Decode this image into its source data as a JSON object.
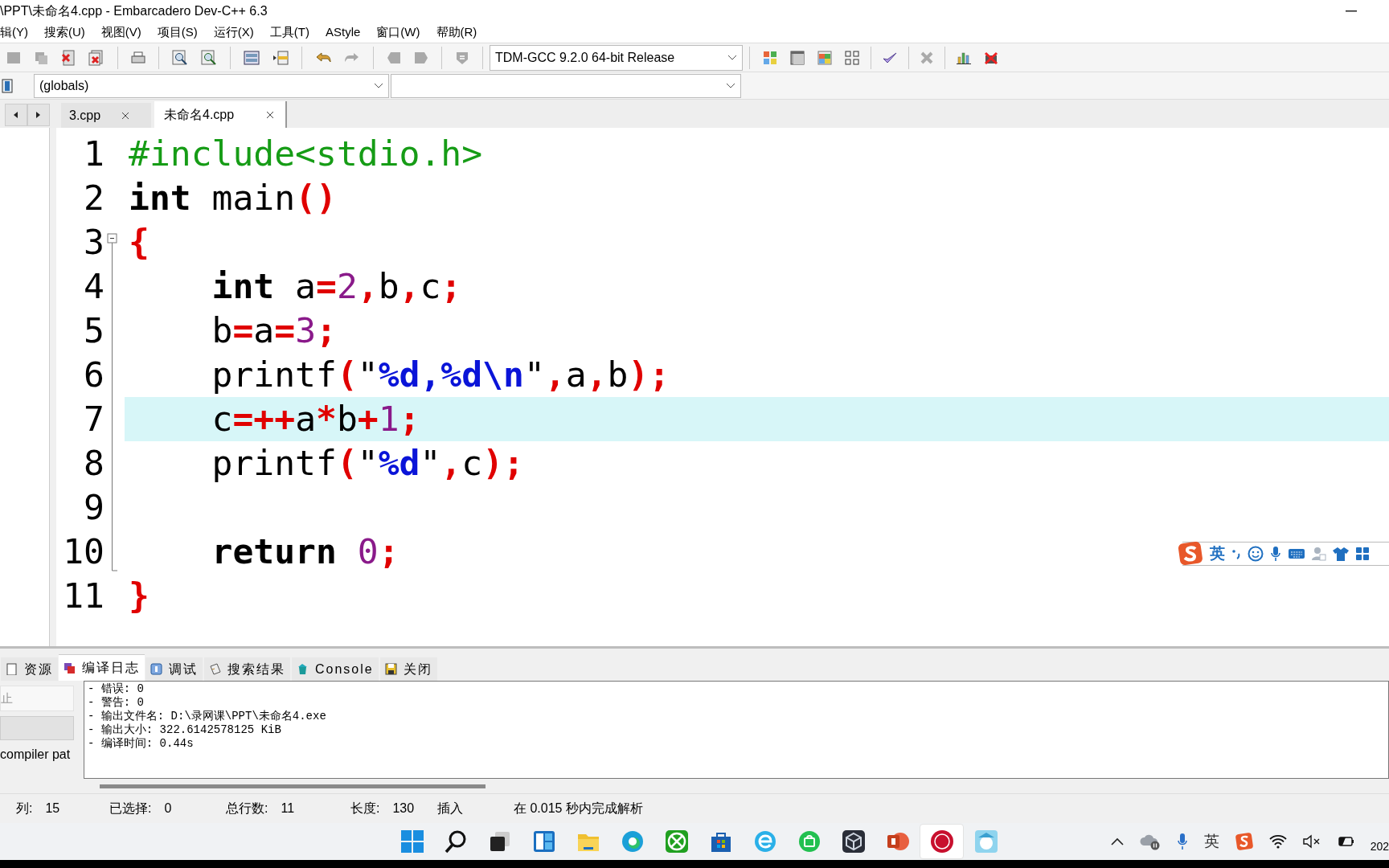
{
  "window": {
    "title": "\\PPT\\未命名4.cpp - Embarcadero Dev-C++ 6.3"
  },
  "menu": [
    "辑(Y)",
    "搜索(U)",
    "视图(V)",
    "项目(S)",
    "运行(X)",
    "工具(T)",
    "AStyle",
    "窗口(W)",
    "帮助(R)"
  ],
  "toolbar": {
    "compiler": "TDM-GCC 9.2.0 64-bit Release"
  },
  "class_bar": {
    "scope": "(globals)"
  },
  "file_tabs": [
    {
      "label": "3.cpp",
      "selected": false
    },
    {
      "label": "未命名4.cpp",
      "selected": true
    }
  ],
  "editor": {
    "lines": [
      {
        "number": "1",
        "highlighted": false,
        "tokens": [
          {
            "kind": "pre",
            "text": "#include<stdio.h>"
          }
        ]
      },
      {
        "number": "2",
        "highlighted": false,
        "tokens": [
          {
            "kind": "kw",
            "text": "int"
          },
          {
            "kind": "id",
            "text": " main"
          },
          {
            "kind": "sym",
            "text": "()"
          }
        ]
      },
      {
        "number": "3",
        "highlighted": false,
        "tokens": [
          {
            "kind": "sym",
            "text": "{"
          }
        ]
      },
      {
        "number": "4",
        "highlighted": false,
        "tokens": [
          {
            "kind": "kw",
            "text": "    int"
          },
          {
            "kind": "id",
            "text": " a"
          },
          {
            "kind": "sym",
            "text": "="
          },
          {
            "kind": "num",
            "text": "2"
          },
          {
            "kind": "sym",
            "text": ","
          },
          {
            "kind": "id",
            "text": "b"
          },
          {
            "kind": "sym",
            "text": ","
          },
          {
            "kind": "id",
            "text": "c"
          },
          {
            "kind": "sym",
            "text": ";"
          }
        ]
      },
      {
        "number": "5",
        "highlighted": false,
        "tokens": [
          {
            "kind": "id",
            "text": "    b"
          },
          {
            "kind": "sym",
            "text": "="
          },
          {
            "kind": "id",
            "text": "a"
          },
          {
            "kind": "sym",
            "text": "="
          },
          {
            "kind": "num",
            "text": "3"
          },
          {
            "kind": "sym",
            "text": ";"
          }
        ]
      },
      {
        "number": "6",
        "highlighted": false,
        "tokens": [
          {
            "kind": "id",
            "text": "    printf"
          },
          {
            "kind": "sym",
            "text": "("
          },
          {
            "kind": "qt",
            "text": "\""
          },
          {
            "kind": "fmt",
            "text": "%d,%d\\n"
          },
          {
            "kind": "qt",
            "text": "\""
          },
          {
            "kind": "sym",
            "text": ","
          },
          {
            "kind": "id",
            "text": "a"
          },
          {
            "kind": "sym",
            "text": ","
          },
          {
            "kind": "id",
            "text": "b"
          },
          {
            "kind": "sym",
            "text": ");"
          }
        ]
      },
      {
        "number": "7",
        "highlighted": true,
        "tokens": [
          {
            "kind": "id",
            "text": "    c"
          },
          {
            "kind": "sym",
            "text": "=++"
          },
          {
            "kind": "id",
            "text": "a"
          },
          {
            "kind": "sym",
            "text": "*"
          },
          {
            "kind": "id",
            "text": "b"
          },
          {
            "kind": "sym",
            "text": "+"
          },
          {
            "kind": "num",
            "text": "1"
          },
          {
            "kind": "sym",
            "text": ";"
          }
        ]
      },
      {
        "number": "8",
        "highlighted": false,
        "tokens": [
          {
            "kind": "id",
            "text": "    printf"
          },
          {
            "kind": "sym",
            "text": "("
          },
          {
            "kind": "qt",
            "text": "\""
          },
          {
            "kind": "fmt",
            "text": "%d"
          },
          {
            "kind": "qt",
            "text": "\""
          },
          {
            "kind": "sym",
            "text": ","
          },
          {
            "kind": "id",
            "text": "c"
          },
          {
            "kind": "sym",
            "text": ");"
          }
        ]
      },
      {
        "number": "9",
        "highlighted": false
      },
      {
        "number": "10",
        "highlighted": false,
        "tokens": [
          {
            "kind": "kw",
            "text": "    return"
          },
          {
            "kind": "num",
            "text": " 0"
          },
          {
            "kind": "sym",
            "text": ";"
          }
        ]
      },
      {
        "number": "11",
        "highlighted": false,
        "tokens": [
          {
            "kind": "sym",
            "text": "}"
          }
        ]
      }
    ]
  },
  "ime_toolbar": {
    "mode": "英"
  },
  "left_panel": {
    "abort_button": "止",
    "compiler_path_label": "compiler pat"
  },
  "bottom_tabs": [
    {
      "label": "资源",
      "selected": false
    },
    {
      "label": "编译日志",
      "selected": true
    },
    {
      "label": "调试",
      "selected": false
    },
    {
      "label": "搜索结果",
      "selected": false
    },
    {
      "label": "Console",
      "selected": false
    },
    {
      "label": "关闭",
      "selected": false
    }
  ],
  "log": [
    "- 错误: 0",
    "- 警告: 0",
    "- 输出文件名: D:\\录网课\\PPT\\未命名4.exe",
    "- 输出大小: 322.6142578125 KiB",
    "- 编译时间: 0.44s"
  ],
  "status_bar": [
    {
      "label": "列:",
      "value": "15"
    },
    {
      "label": "已选择:",
      "value": "0"
    },
    {
      "label": "总行数:",
      "value": "11"
    },
    {
      "label": "长度:",
      "value": "130"
    },
    {
      "label": "插入"
    },
    {
      "label": "在 0.015 秒内完成解析"
    }
  ],
  "taskbar": {
    "apps": [
      {
        "selected": false
      },
      {
        "selected": false
      },
      {
        "selected": false
      },
      {
        "selected": false
      },
      {
        "selected": false
      },
      {
        "selected": false
      },
      {
        "selected": false
      },
      {
        "selected": false
      },
      {
        "selected": false
      },
      {
        "selected": false
      },
      {
        "selected": false
      },
      {
        "selected": true
      },
      {
        "selected": false
      }
    ],
    "ime": "英",
    "clock": "202"
  }
}
